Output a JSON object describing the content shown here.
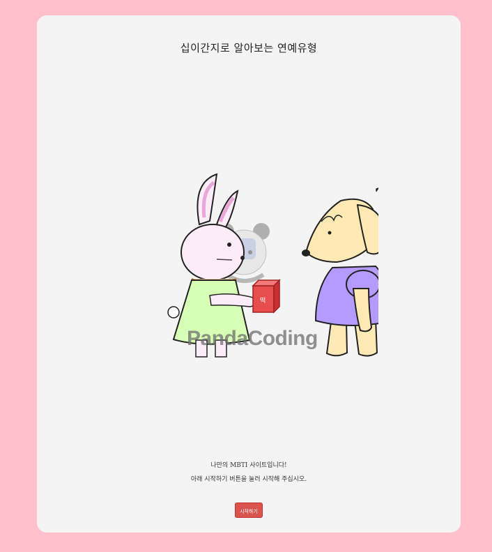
{
  "page": {
    "title": "십이간지로 알아보는 연예유형",
    "watermark": "PandaCoding",
    "description_line1": "나만의 MBTI 사이트입니다!",
    "description_line2": "아래 시작하기 버튼을 눌러 시작해 주십시오.",
    "start_button": "시작하기"
  },
  "colors": {
    "background": "#ffc0cb",
    "card": "#f4f4f4",
    "button": "#d9534f"
  },
  "illustration": {
    "characters": [
      "rabbit",
      "dog"
    ],
    "gift_label": "떡",
    "question_mark": "?"
  }
}
